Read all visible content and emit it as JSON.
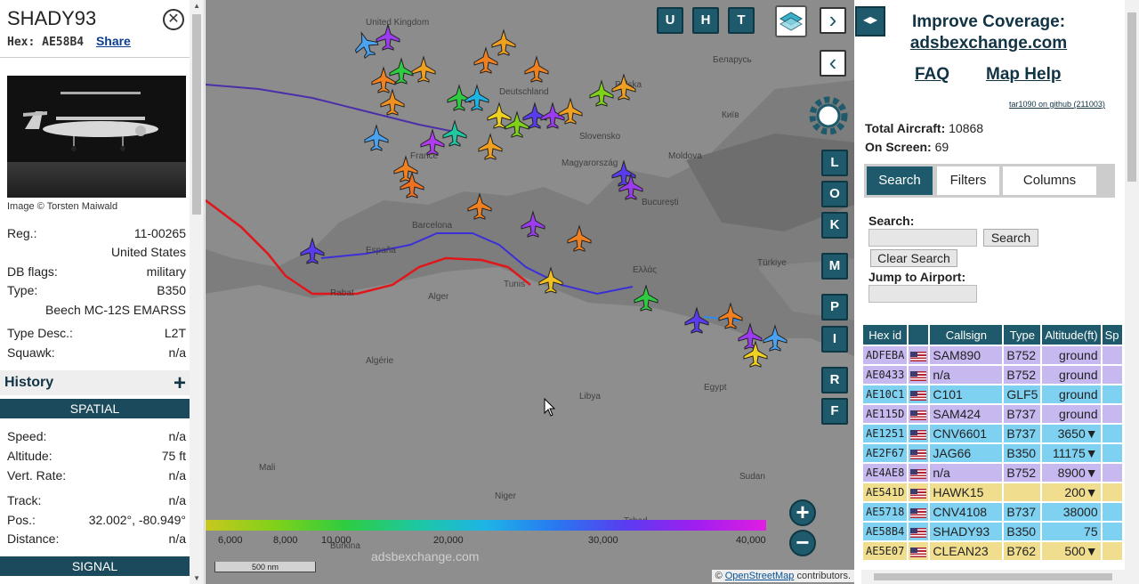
{
  "selected": {
    "callsign": "SHADY93",
    "hex_label": "Hex:",
    "hex": "AE58B4",
    "share": "Share",
    "photo_credit": "Image © Torsten Maiwald",
    "details": [
      {
        "k": "Reg.:",
        "v": "11-00265"
      },
      {
        "k": "",
        "v": "United States"
      },
      {
        "k": "DB flags:",
        "v": "military"
      },
      {
        "k": "Type:",
        "v": "B350"
      },
      {
        "k": "",
        "v": "Beech MC-12S EMARSS"
      },
      {
        "k": "Type Desc.:",
        "v": "L2T"
      },
      {
        "k": "Squawk:",
        "v": "n/a"
      }
    ],
    "history_title": "History",
    "history_toggle": "+",
    "spatial_title": "SPATIAL",
    "spatial": [
      {
        "k": "Speed:",
        "v": "n/a"
      },
      {
        "k": "Altitude:",
        "v": "75 ft"
      },
      {
        "k": "Vert. Rate:",
        "v": "n/a"
      },
      {
        "k": "Track:",
        "v": "n/a"
      },
      {
        "k": "Pos.:",
        "v": "32.002°, -80.949°"
      },
      {
        "k": "Distance:",
        "v": "n/a"
      }
    ],
    "signal_title": "SIGNAL"
  },
  "map": {
    "buttons_top": [
      "U",
      "H",
      "T"
    ],
    "buttons_side": [
      "L",
      "O",
      "K",
      "M",
      "P",
      "I",
      "R",
      "F"
    ],
    "altitude_labels": [
      "6,000",
      "8,000",
      "10,000",
      "20,000",
      "30,000",
      "40,000"
    ],
    "scale": "500 nm",
    "watermark": "adsbexchange.com",
    "attribution_prefix": "©",
    "attribution_link": "OpenStreetMap",
    "attribution_suffix": "contributors.",
    "place_labels": [
      "United Kingdom",
      "Deutschland",
      "France",
      "Barcelona",
      "España",
      "Rabat",
      "Alger",
      "Tunis",
      "Libya",
      "Egypt",
      "Türkiye",
      "Беларусь",
      "Київ",
      "Magyarország",
      "București",
      "Ελλάς",
      "Niger",
      "Tchad",
      "Burkina",
      "Slovensko",
      "Polska",
      "Moldova",
      "Algérie",
      "Mali",
      "Sudan"
    ],
    "icons": {
      "zoom_in": "+",
      "zoom_out": "−"
    }
  },
  "panel": {
    "improve_title": "Improve Coverage:",
    "improve_link": "adsbexchange.com",
    "faq": "FAQ",
    "map_help": "Map Help",
    "version": "tar1090 on github (211003)",
    "total_label": "Total Aircraft:",
    "total_value": "10868",
    "onscreen_label": "On Screen:",
    "onscreen_value": "69",
    "tabs": [
      "Search",
      "Filters",
      "Columns"
    ],
    "search_label": "Search:",
    "search_button": "Search",
    "clear_button": "Clear Search",
    "jump_label": "Jump to Airport:",
    "columns": [
      "Hex id",
      "",
      "Callsign",
      "Type",
      "Altitude(ft)",
      "Sp"
    ],
    "rows": [
      {
        "hex": "ADFEBA",
        "callsign": "SAM890",
        "type": "B752",
        "alt": "ground",
        "color": "purple"
      },
      {
        "hex": "AE0433",
        "callsign": "n/a",
        "type": "B752",
        "alt": "ground",
        "color": "purple"
      },
      {
        "hex": "AE10C1",
        "callsign": "C101",
        "type": "GLF5",
        "alt": "ground",
        "color": "blue"
      },
      {
        "hex": "AE115D",
        "callsign": "SAM424",
        "type": "B737",
        "alt": "ground",
        "color": "purple"
      },
      {
        "hex": "AE1251",
        "callsign": "CNV6601",
        "type": "B737",
        "alt": "3650▼",
        "color": "blue"
      },
      {
        "hex": "AE2F67",
        "callsign": "JAG66",
        "type": "B350",
        "alt": "11175▼",
        "color": "blue"
      },
      {
        "hex": "AE4AE8",
        "callsign": "n/a",
        "type": "B752",
        "alt": "8900▼",
        "color": "purple"
      },
      {
        "hex": "AE541D",
        "callsign": "HAWK15",
        "type": "",
        "alt": "200▼",
        "color": "yellow"
      },
      {
        "hex": "AE5718",
        "callsign": "CNV4108",
        "type": "B737",
        "alt": "38000",
        "color": "blue"
      },
      {
        "hex": "AE58B4",
        "callsign": "SHADY93",
        "type": "B350",
        "alt": "75",
        "color": "blue"
      },
      {
        "hex": "AE5E07",
        "callsign": "CLEAN23",
        "type": "B762",
        "alt": "500▼",
        "color": "yellow"
      }
    ]
  }
}
